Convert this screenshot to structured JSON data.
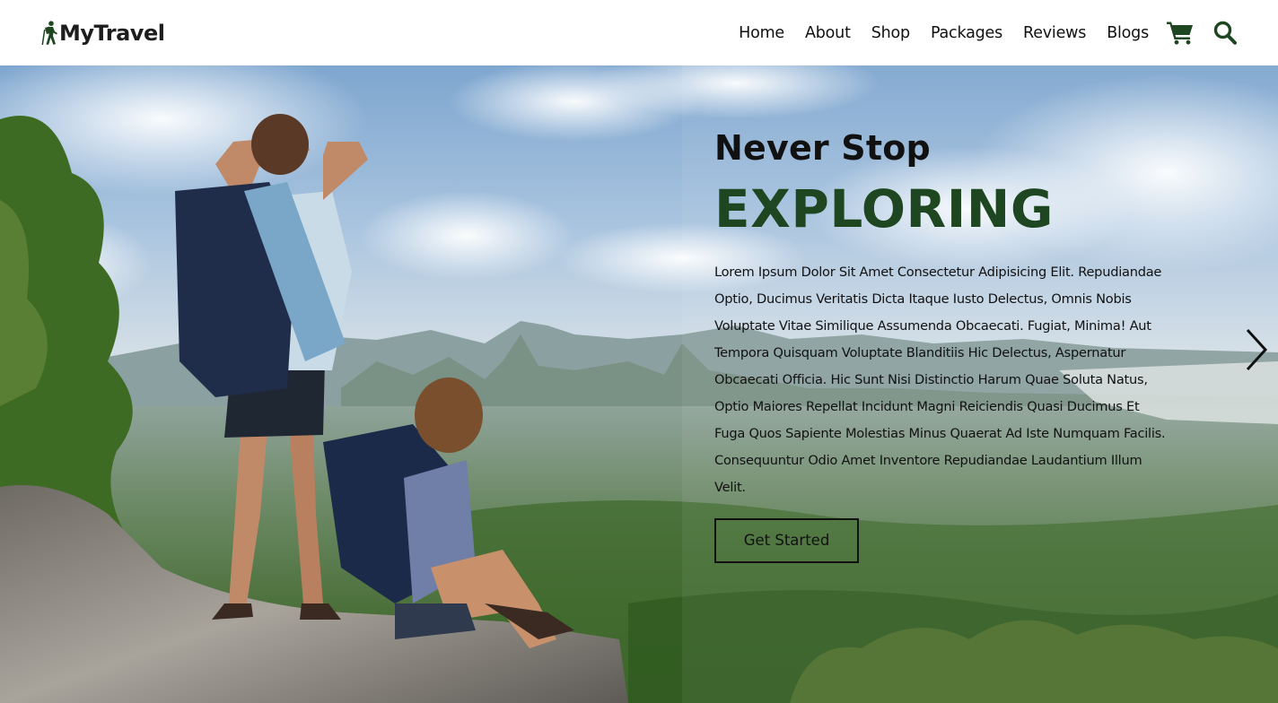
{
  "brand": {
    "name": "MyTravel",
    "icon": "hiker-icon",
    "color": "#1e4620"
  },
  "nav": {
    "links": [
      "Home",
      "About",
      "Shop",
      "Packages",
      "Reviews",
      "Blogs"
    ],
    "icons": [
      "cart-icon",
      "search-icon"
    ]
  },
  "hero": {
    "pretitle": "Never Stop",
    "title": "EXPLORING",
    "title_color": "#1e4620",
    "description": "Lorem Ipsum Dolor Sit Amet Consectetur Adipisicing Elit. Repudiandae Optio, Ducimus Veritatis Dicta Itaque Iusto Delectus, Omnis Nobis Voluptate Vitae Similique Assumenda Obcaecati. Fugiat, Minima! Aut Tempora Quisquam Voluptate Blanditiis Hic Delectus, Aspernatur Obcaecati Officia. Hic Sunt Nisi Distinctio Harum Quae Soluta Natus, Optio Maiores Repellat Incidunt Magni Reiciendis Quasi Ducimus Et Fuga Quos Sapiente Molestias Minus Quaerat Ad Iste Numquam Facilis. Consequuntur Odio Amet Inventore Repudiandae Laudantium Illum Velit.",
    "cta_label": "Get Started",
    "next_icon": "chevron-right-icon",
    "background": "hikers-on-mountain-cliff-image"
  }
}
